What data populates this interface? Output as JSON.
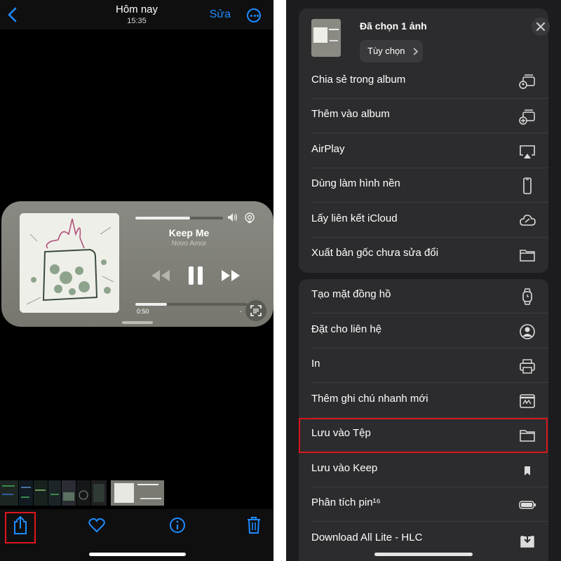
{
  "left": {
    "header": {
      "title": "Hôm nay",
      "time": "15:35",
      "edit_label": "Sửa"
    },
    "player": {
      "song": "Keep Me",
      "artist": "Novo Amor",
      "elapsed": "0:50",
      "remaining": "-",
      "volume_fraction": 0.62,
      "progress_fraction": 0.28
    },
    "toolbar": {
      "share_icon": "share-icon",
      "favorite_icon": "heart-icon",
      "info_icon": "info-icon",
      "delete_icon": "trash-icon"
    },
    "accent": "#1d8cff",
    "highlight": "#e0161e"
  },
  "right": {
    "sheet_header": {
      "title": "Đã chọn 1 ảnh",
      "options_label": "Tùy chọn"
    },
    "group1": [
      {
        "label": "Chia sẻ trong album",
        "icon": "shared-album-icon"
      },
      {
        "label": "Thêm vào album",
        "icon": "add-album-icon"
      },
      {
        "label": "AirPlay",
        "icon": "airplay-icon"
      },
      {
        "label": "Dùng làm hình nền",
        "icon": "phone-icon"
      },
      {
        "label": "Lấy liên kết iCloud",
        "icon": "link-cloud-icon"
      },
      {
        "label": "Xuất bản gốc chưa sửa đổi",
        "icon": "folder-icon"
      }
    ],
    "group2": [
      {
        "label": "Tạo mặt đồng hồ",
        "icon": "watch-icon"
      },
      {
        "label": "Đặt cho liên hệ",
        "icon": "contact-icon"
      },
      {
        "label": "In",
        "icon": "printer-icon"
      },
      {
        "label": "Thêm ghi chú nhanh mới",
        "icon": "quick-note-icon"
      },
      {
        "label": "Lưu vào Tệp",
        "icon": "folder-icon"
      },
      {
        "label": "Lưu vào Keep",
        "icon": "bookmark-icon"
      },
      {
        "label": "Phân tích pin¹⁶",
        "icon": "battery-icon"
      },
      {
        "label": "Download All Lite - HLC",
        "icon": "download-icon"
      }
    ]
  }
}
